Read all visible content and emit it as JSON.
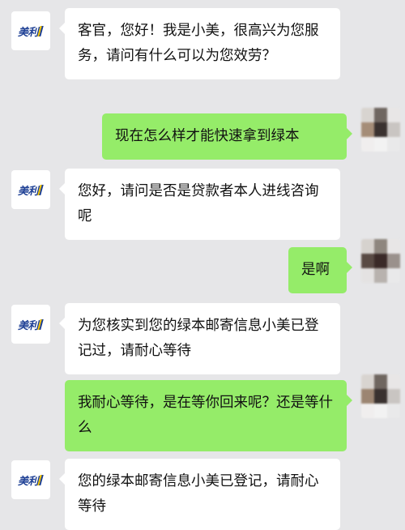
{
  "chat": {
    "agent_logo_text": "美利",
    "messages": [
      {
        "sender": "agent",
        "text": "客官，您好！我是小美，很高兴为您服务，请问有什么可以为您效劳？"
      },
      {
        "sender": "user",
        "text": "现在怎么样才能快速拿到绿本"
      },
      {
        "sender": "agent",
        "text": "您好，请问是否是贷款者本人进线咨询呢"
      },
      {
        "sender": "user",
        "text": "是啊"
      },
      {
        "sender": "agent",
        "text": "为您核实到您的绿本邮寄信息小美已登记过，请耐心等待"
      },
      {
        "sender": "user",
        "text": "我耐心等待，是在等你回来呢？还是等什么"
      },
      {
        "sender": "agent",
        "text": "您的绿本邮寄信息小美已登记，请耐心等待"
      }
    ]
  },
  "colors": {
    "background": "#e6e6e8",
    "agent_bubble": "#ffffff",
    "user_bubble": "#95ec69",
    "logo_blue": "#1d3f94",
    "logo_yellow": "#f2c300"
  }
}
